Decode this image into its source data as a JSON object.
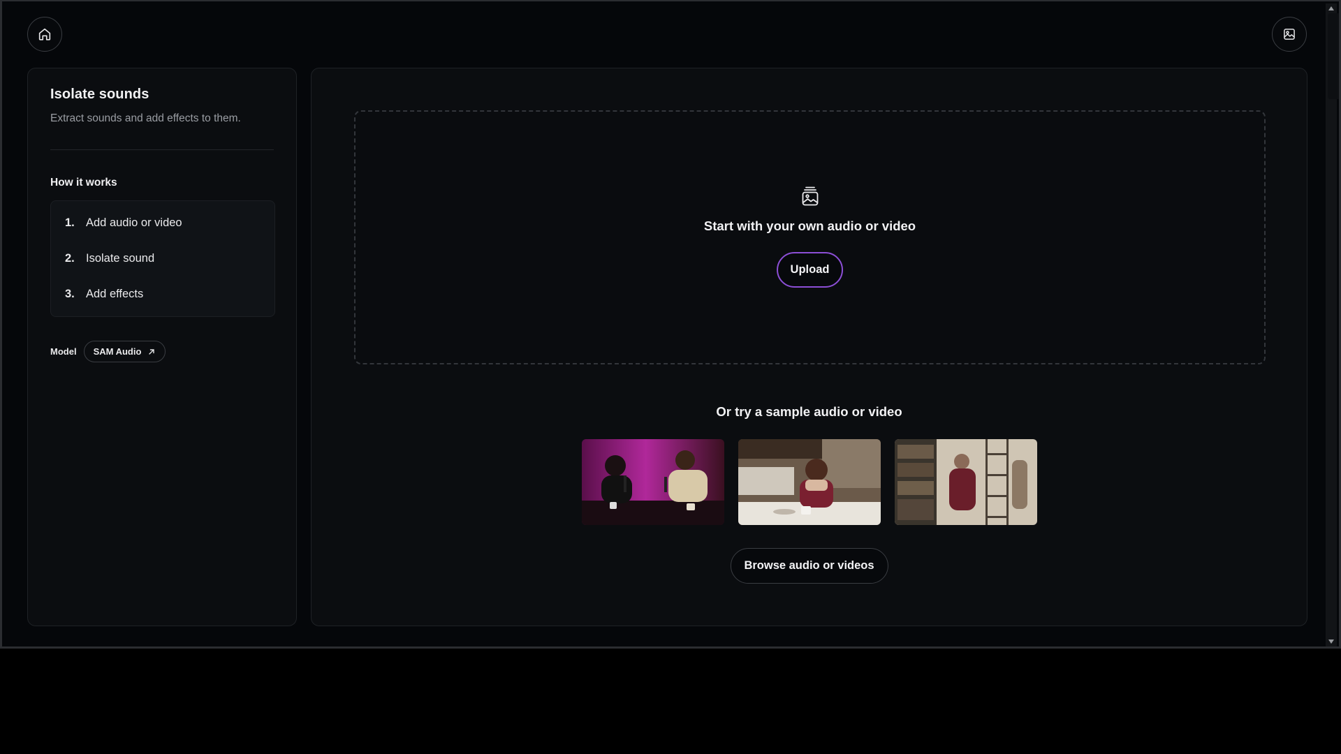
{
  "header": {
    "home_icon": "home-icon",
    "gallery_icon": "image-gallery-icon"
  },
  "sidebar": {
    "title": "Isolate sounds",
    "subtitle": "Extract sounds and add effects to them.",
    "how_it_works": "How it works",
    "steps": [
      {
        "num": "1.",
        "label": "Add audio or video"
      },
      {
        "num": "2.",
        "label": "Isolate sound"
      },
      {
        "num": "3.",
        "label": "Add effects"
      }
    ],
    "model_label": "Model",
    "model_name": "SAM Audio",
    "model_link_icon": "arrow-up-right-icon"
  },
  "main": {
    "dropzone": {
      "icon": "media-file-icon",
      "title": "Start with your own audio or video",
      "upload_label": "Upload"
    },
    "samples": {
      "title": "Or try a sample audio or video",
      "items": [
        "podcast-two-people",
        "woman-in-cafe",
        "man-in-library"
      ],
      "browse_label": "Browse audio or videos"
    }
  },
  "colors": {
    "background": "#05070a",
    "panel": "#0b0d10",
    "upload_border": "#8c4fd6"
  }
}
